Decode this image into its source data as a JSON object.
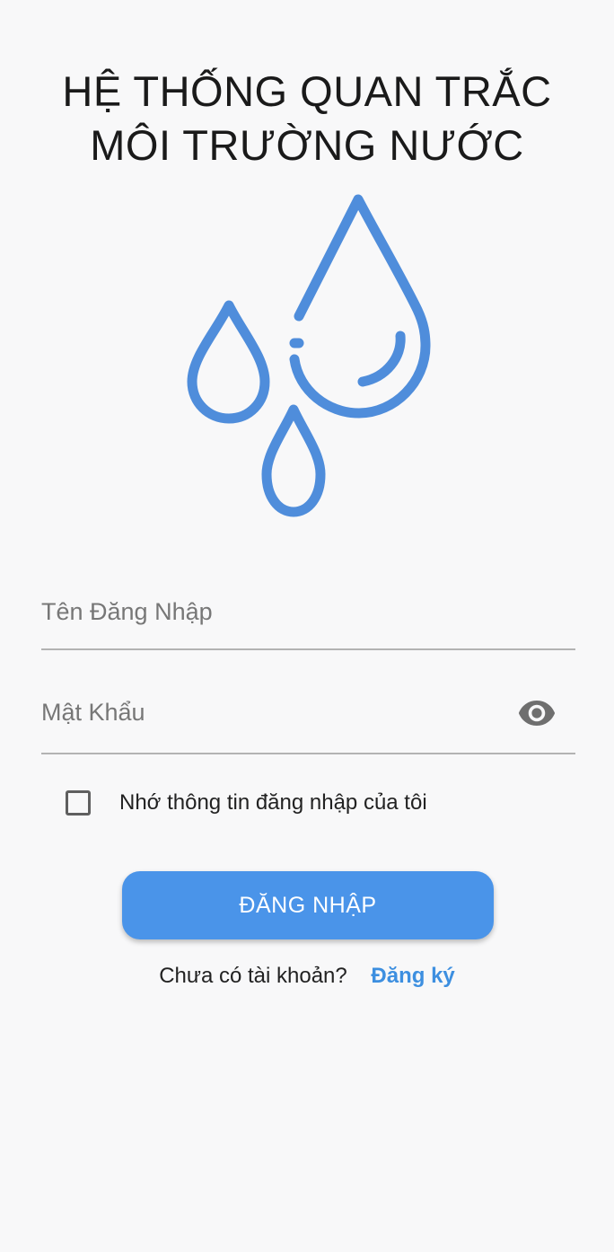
{
  "app": {
    "title_line1": "HỆ THỐNG QUAN TRẮC",
    "title_line2": "MÔI TRƯỜNG NƯỚC",
    "logo_icon": "water-drops-icon",
    "accent_color": "#4a94e9"
  },
  "form": {
    "username_placeholder": "Tên Đăng Nhập",
    "username_value": "",
    "password_placeholder": "Mật Khẩu",
    "password_value": "",
    "password_toggle_icon": "eye-icon",
    "remember_label": "Nhớ thông tin đăng nhập của tôi",
    "remember_checked": false,
    "login_label": "ĐĂNG NHẬP"
  },
  "signup": {
    "question": "Chưa có tài khoản?",
    "link": "Đăng ký"
  }
}
